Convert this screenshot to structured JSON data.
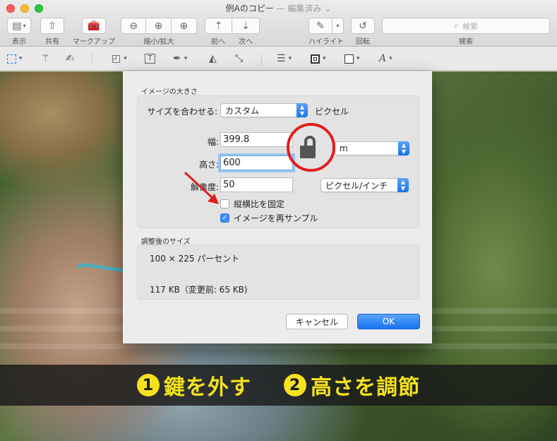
{
  "window": {
    "title": "例Aのコピー",
    "edited": "— 編集済み ⌄"
  },
  "toolbar": {
    "view_label": "表示",
    "share_label": "共有",
    "markup_label": "マークアップ",
    "zoom_label": "縮小/拡大",
    "prev_label": "前へ",
    "next_label": "次へ",
    "highlight_label": "ハイライト",
    "rotate_label": "回転",
    "search_placeholder": "検索",
    "search_label": "検索"
  },
  "dialog": {
    "size_section_title": "イメージの大きさ",
    "fit_label": "サイズを合わせる:",
    "fit_value": "カスタム",
    "fit_unit": "ピクセル",
    "width_label": "幅:",
    "width_value": "399.8",
    "height_label": "高さ:",
    "height_value": "600",
    "unit_value": "m",
    "resolution_label": "解像度:",
    "resolution_value": "50",
    "resolution_unit": "ピクセル/インチ",
    "scale_proportionally_label": "縦横比を固定",
    "scale_proportionally_checked": false,
    "resample_label": "イメージを再サンプル",
    "resample_checked": true,
    "result_section_title": "調整後のサイズ",
    "result_percent": "100 × 225 パーセント",
    "result_filesize": "117 KB（変更前: 65 KB)",
    "cancel_label": "キャンセル",
    "ok_label": "OK"
  },
  "banner": {
    "step1_num": "1",
    "step1_text": "鍵を外す",
    "step2_num": "2",
    "step2_text": "高さを調節"
  },
  "colors": {
    "accent": "#1673ee",
    "annotation_red": "#e21e1e",
    "banner_text": "#f5e21d"
  }
}
